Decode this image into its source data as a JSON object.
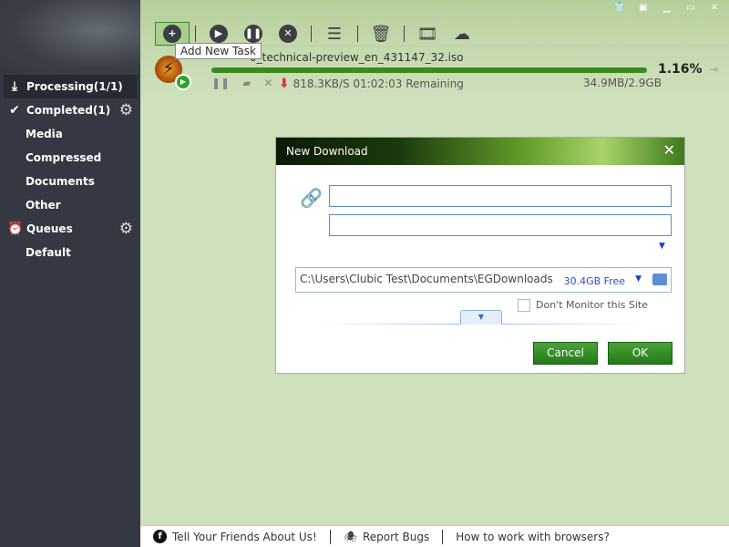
{
  "sidebar": {
    "items": [
      {
        "label": "Processing(1/1)",
        "icon": "download-icon"
      },
      {
        "label": "Completed(1)",
        "icon": "check-circle-icon"
      },
      {
        "label": "Media"
      },
      {
        "label": "Compressed"
      },
      {
        "label": "Documents"
      },
      {
        "label": "Other"
      },
      {
        "label": "Queues",
        "icon": "alarm-clock-icon"
      },
      {
        "label": "Default"
      }
    ]
  },
  "toolbar": {
    "tooltip": "Add New Task"
  },
  "download": {
    "filename": "0_technical-preview_en_431147_32.iso",
    "progress_percent": 1.16,
    "progress_label": "1.16%",
    "speed": "818.3KB/S 01:02:03 Remaining",
    "size": "34.9MB/2.9GB"
  },
  "dialog": {
    "title": "New Download",
    "url_value": "",
    "name_value": "",
    "path": "C:\\Users\\Clubic Test\\Documents\\EGDownloads",
    "free": "30.4GB Free",
    "dont_monitor_label": "Don't Monitor this Site",
    "dont_monitor_checked": false,
    "cancel": "Cancel",
    "ok": "OK"
  },
  "footer": {
    "links": [
      "Tell Your Friends About Us!",
      "Report Bugs",
      "How to work with browsers?"
    ]
  },
  "colors": {
    "accent": "#3a8a1f",
    "sidebar": "#333842"
  }
}
